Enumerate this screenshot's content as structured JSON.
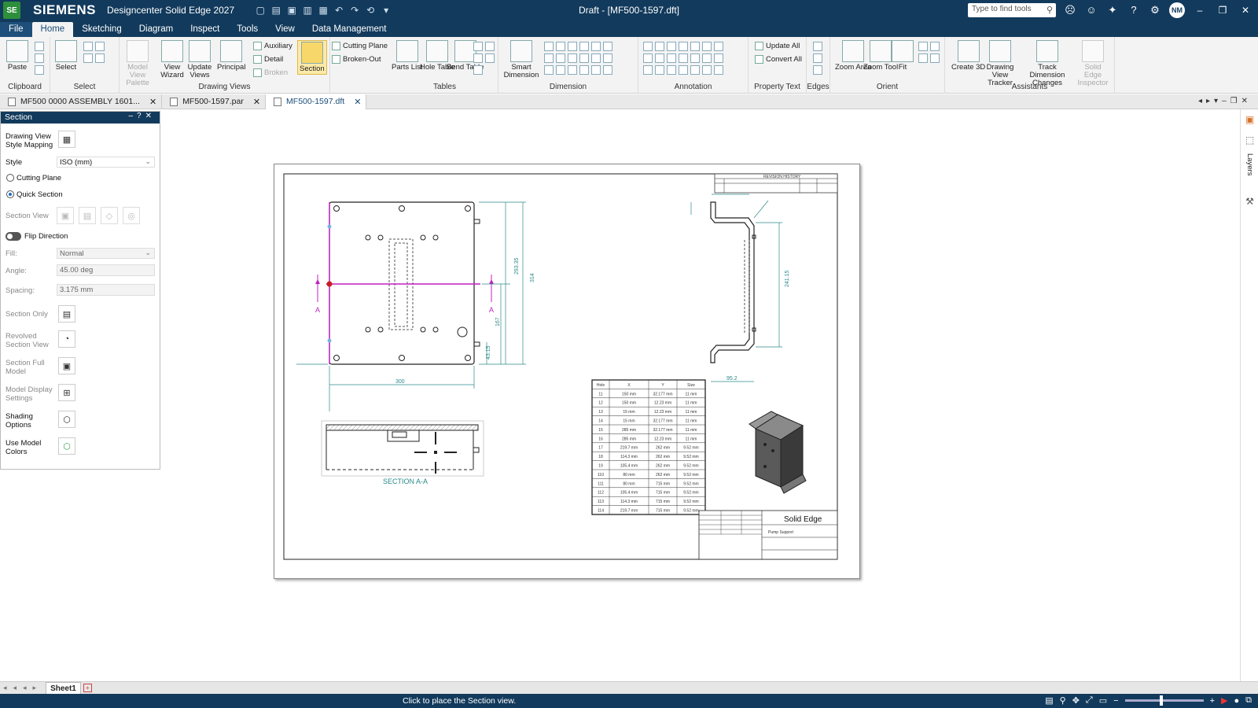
{
  "titlebar": {
    "app_icon": "SE",
    "brand": "SIEMENS",
    "app_name": "Designcenter Solid Edge 2027",
    "doc_title": "Draft - [MF500-1597.dft]",
    "search_placeholder": "Type to find tools",
    "avatar": "NM"
  },
  "menu": {
    "file": "File",
    "tabs": [
      "Home",
      "Sketching",
      "Diagram",
      "Inspect",
      "Tools",
      "View",
      "Data Management"
    ]
  },
  "ribbon": {
    "groups": {
      "clipboard": "Clipboard",
      "select": "Select",
      "drawing_views": "Drawing Views",
      "tables": "Tables",
      "dimension": "Dimension",
      "annotation": "Annotation",
      "property_text": "Property Text",
      "edges": "Edges",
      "orient": "Orient",
      "assistants": "Assistants"
    },
    "buttons": {
      "paste": "Paste",
      "select": "Select",
      "model_view_palette": "Model View Palette",
      "view_wizard": "View Wizard",
      "update_views": "Update Views",
      "principal": "Principal",
      "auxiliary": "Auxiliary",
      "detail": "Detail",
      "broken": "Broken",
      "section": "Section",
      "cutting_plane": "Cutting Plane",
      "broken_out": "Broken-Out",
      "parts_list": "Parts List",
      "hole_table": "Hole Table",
      "bend_table": "Bend Table",
      "smart_dimension": "Smart Dimension",
      "update_all": "Update All",
      "convert_all": "Convert All",
      "zoom_area": "Zoom Area",
      "zoom_tool": "Zoom Tool",
      "fit": "Fit",
      "create_3d": "Create 3D",
      "drawing_view_tracker": "Drawing View Tracker",
      "track_dimension_changes": "Track Dimension Changes",
      "solid_edge_inspector": "Solid Edge Inspector"
    }
  },
  "doc_tabs": [
    {
      "label": "MF500 0000 ASSEMBLY 1601...",
      "active": false
    },
    {
      "label": "MF500-1597.par",
      "active": false
    },
    {
      "label": "MF500-1597.dft",
      "active": true
    }
  ],
  "panel": {
    "title": "Section",
    "style_mapping": "Drawing View Style Mapping",
    "style_label": "Style",
    "style_value": "ISO (mm)",
    "cutting_plane": "Cutting Plane",
    "quick_section": "Quick Section",
    "section_view": "Section View",
    "flip_direction": "Flip Direction",
    "fill_label": "Fill:",
    "fill_value": "Normal",
    "angle_label": "Angle:",
    "angle_value": "45.00 deg",
    "spacing_label": "Spacing:",
    "spacing_value": "3.175 mm",
    "section_only": "Section Only",
    "revolved_section_view": "Revolved Section View",
    "section_full_model": "Section Full Model",
    "model_display_settings": "Model Display Settings",
    "shading_options": "Shading Options",
    "use_model_colors": "Use Model Colors"
  },
  "drawing": {
    "section_label": "SECTION A-A",
    "marker": "A",
    "dim_300": "300",
    "dim_293": "293.35",
    "dim_314": "314",
    "dim_167": "167",
    "dim_45": "43.15",
    "dim_952": "95.2",
    "dim_2415": "241.15",
    "dim_10": "10",
    "title_block_company": "Solid Edge",
    "title_block_desc": "Pump Support",
    "revision_history": "REVISION HISTORY",
    "hole_table": {
      "headers": [
        "Hole",
        "X",
        "Y",
        "Size"
      ],
      "rows": [
        [
          "11",
          "150 mm",
          "32.177 mm",
          "11 mm"
        ],
        [
          "12",
          "150 mm",
          "12.23 mm",
          "11 mm"
        ],
        [
          "13",
          "15 mm",
          "12.23 mm",
          "11 mm"
        ],
        [
          "14",
          "15 mm",
          "32.177 mm",
          "11 mm"
        ],
        [
          "15",
          "285 mm",
          "32.177 mm",
          "11 mm"
        ],
        [
          "16",
          "285 mm",
          "12.23 mm",
          "11 mm"
        ],
        [
          "17",
          "219.7 mm",
          "262 mm",
          "9.52 mm"
        ],
        [
          "18",
          "114.3 mm",
          "262 mm",
          "9.52 mm"
        ],
        [
          "19",
          "105.4 mm",
          "262 mm",
          "9.52 mm"
        ],
        [
          "110",
          "80 mm",
          "262 mm",
          "9.52 mm"
        ],
        [
          "111",
          "80 mm",
          "715 mm",
          "9.52 mm"
        ],
        [
          "112",
          "105.4 mm",
          "715 mm",
          "9.52 mm"
        ],
        [
          "113",
          "114.3 mm",
          "715 mm",
          "9.52 mm"
        ],
        [
          "114",
          "219.7 mm",
          "715 mm",
          "9.52 mm"
        ]
      ]
    }
  },
  "sheetbar": {
    "sheet_name": "Sheet1"
  },
  "status": {
    "message": "Click to place the Section view."
  },
  "right_strip": {
    "layers": "Layers"
  },
  "colors": {
    "title_bar": "#123a5c",
    "accent_selected": "#fdeaa8",
    "dimension": "#2b8a8a",
    "cutting_line": "#c020c0"
  }
}
